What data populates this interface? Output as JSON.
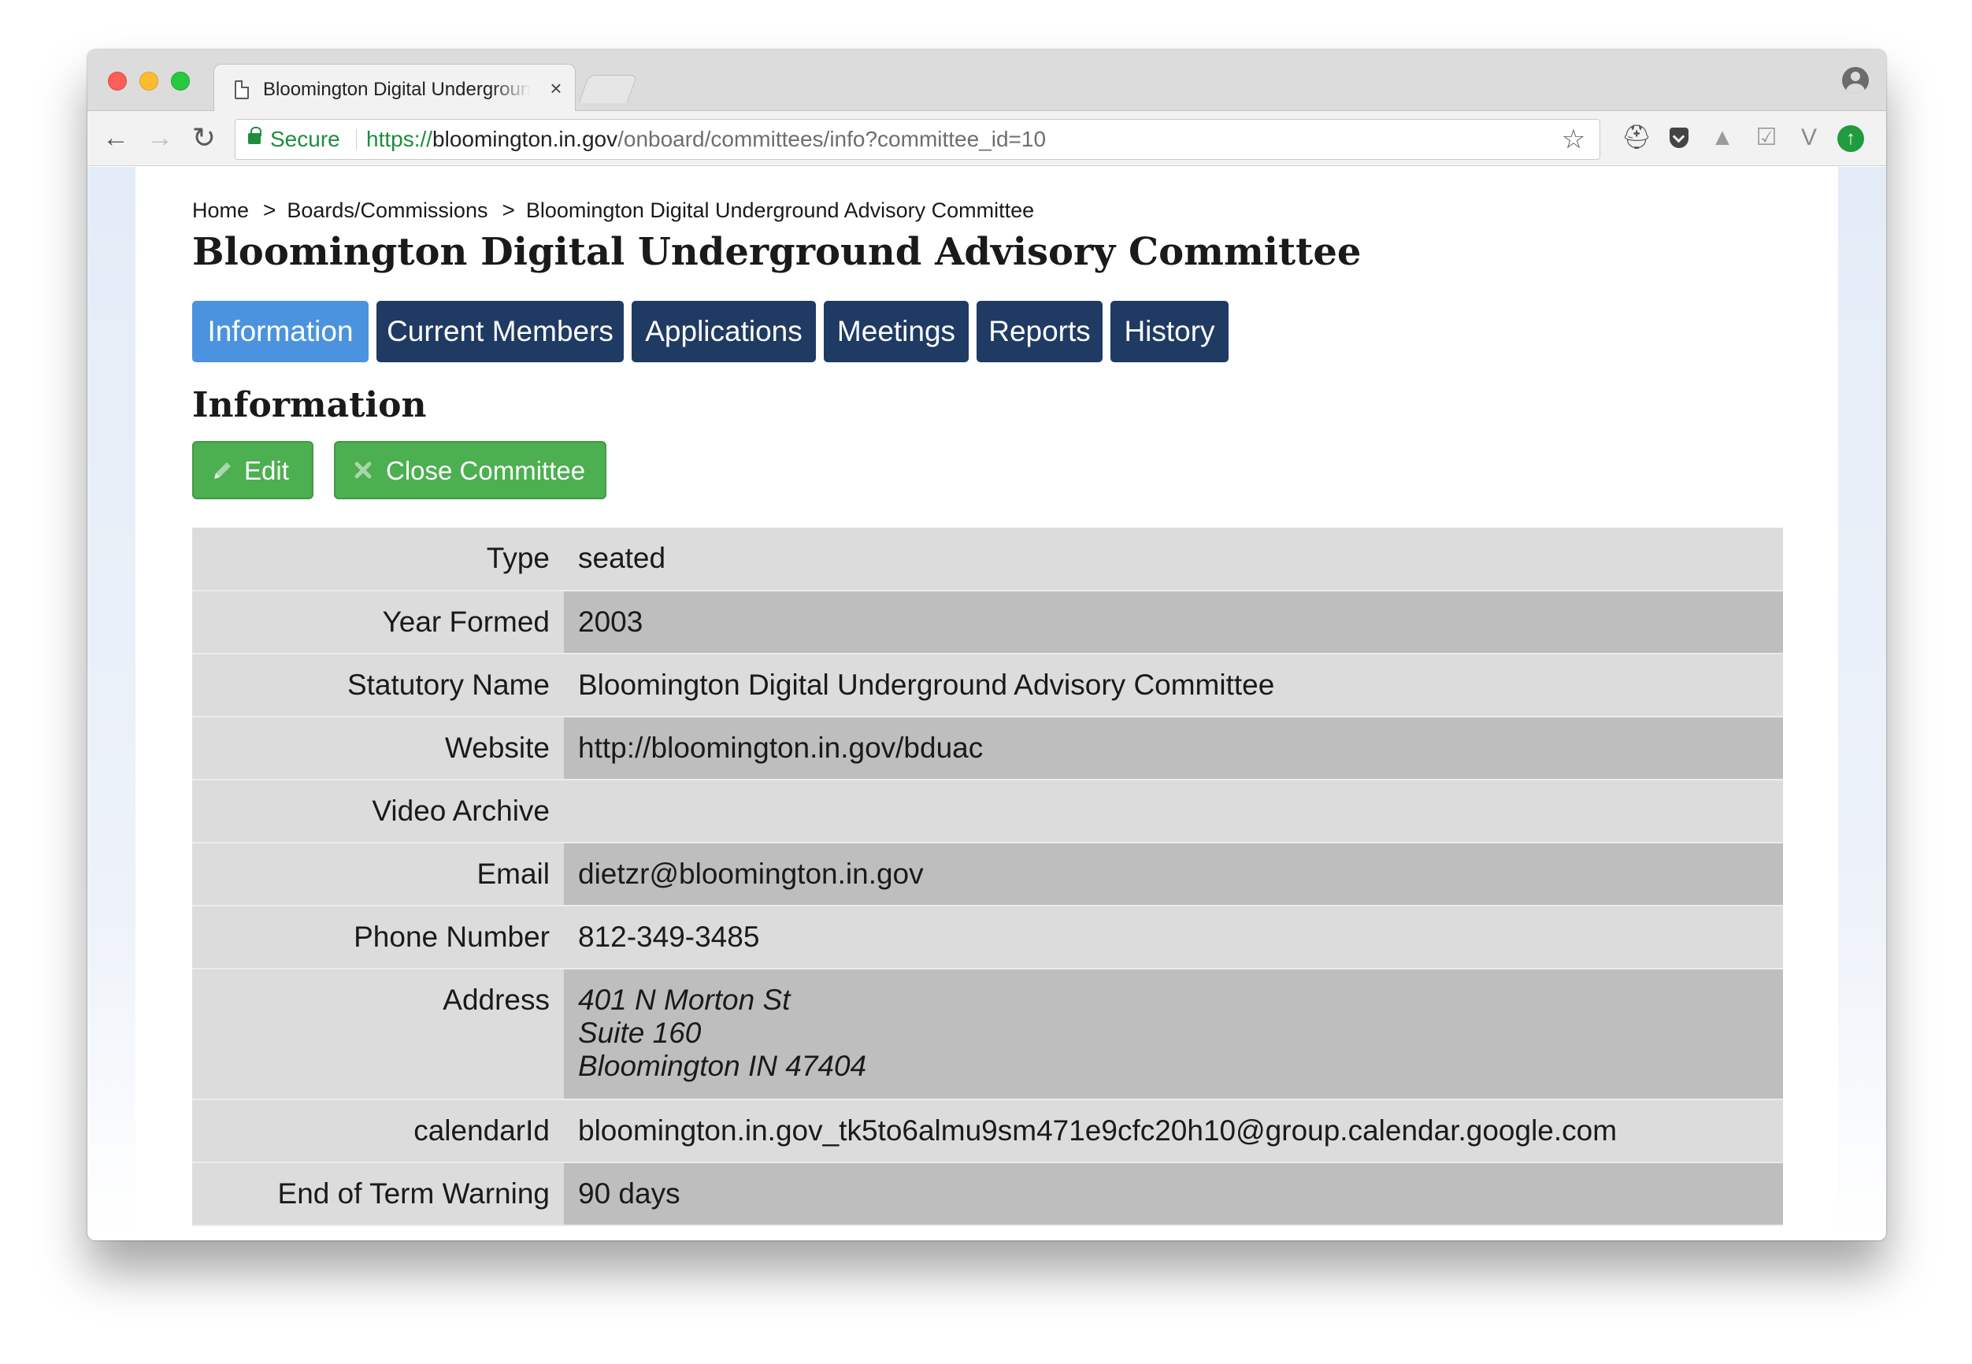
{
  "browser": {
    "tab_title": "Bloomington Digital Underground Advisory Committee",
    "tab_close": "×",
    "secure_label": "Secure",
    "url_scheme": "https://",
    "url_host": "bloomington.in.gov",
    "url_path": "/onboard/committees/info?committee_id=10"
  },
  "breadcrumb": {
    "items": [
      "Home",
      "Boards/Commissions",
      "Bloomington Digital Underground Advisory Committee"
    ],
    "separator": ">"
  },
  "page_title": "Bloomington Digital Underground Advisory Committee",
  "tabs": [
    {
      "label": "Information",
      "active": true
    },
    {
      "label": "Current Members",
      "active": false
    },
    {
      "label": "Applications",
      "active": false
    },
    {
      "label": "Meetings",
      "active": false
    },
    {
      "label": "Reports",
      "active": false
    },
    {
      "label": "History",
      "active": false
    }
  ],
  "section_title": "Information",
  "actions": {
    "edit_label": "Edit",
    "close_label": "Close Committee"
  },
  "info": {
    "type": {
      "label": "Type",
      "value": "seated"
    },
    "year_formed": {
      "label": "Year Formed",
      "value": "2003"
    },
    "statutory_name": {
      "label": "Statutory Name",
      "value": "Bloomington Digital Underground Advisory Committee"
    },
    "website": {
      "label": "Website",
      "value": "http://bloomington.in.gov/bduac"
    },
    "video_archive": {
      "label": "Video Archive",
      "value": ""
    },
    "email": {
      "label": "Email",
      "value": "dietzr@bloomington.in.gov"
    },
    "phone": {
      "label": "Phone Number",
      "value": "812-349-3485"
    },
    "address": {
      "label": "Address",
      "lines": [
        "401 N Morton St",
        "Suite 160",
        "Bloomington IN 47404"
      ]
    },
    "calendar_id": {
      "label": "calendarId",
      "value": "bloomington.in.gov_tk5to6almu9sm471e9cfc20h10@group.calendar.google.com"
    },
    "end_of_term_warning": {
      "label": "End of Term Warning",
      "value": "90 days"
    }
  },
  "colors": {
    "tab_active": "#4b93de",
    "tab_inactive": "#1f3a63",
    "action_green": "#4caf50",
    "secure_green": "#1e8e3e"
  }
}
